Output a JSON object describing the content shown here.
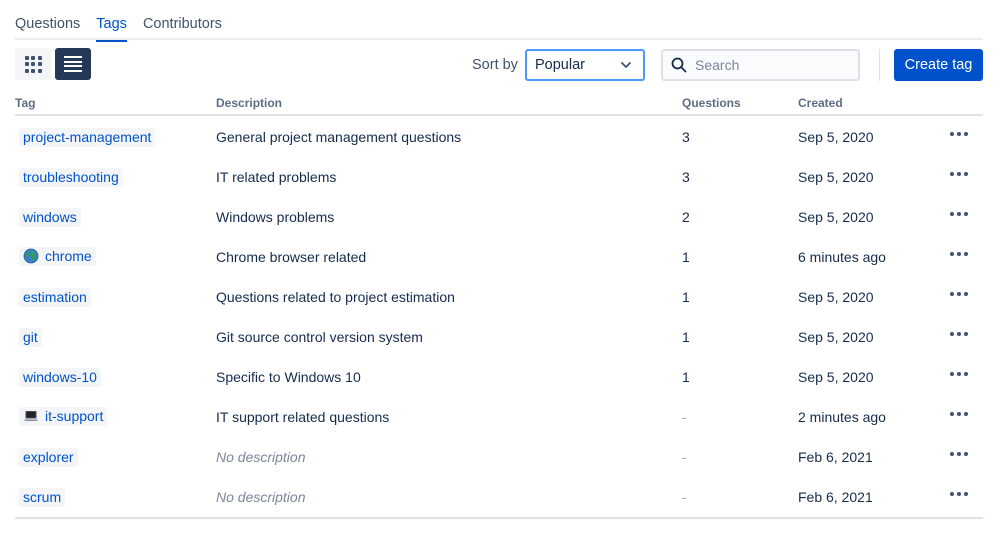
{
  "tabs": [
    {
      "label": "Questions",
      "active": false
    },
    {
      "label": "Tags",
      "active": true
    },
    {
      "label": "Contributors",
      "active": false
    }
  ],
  "toolbar": {
    "grid_view_icon": "grid-icon",
    "list_view_icon": "list-icon",
    "sort_label": "Sort by",
    "sort_value": "Popular",
    "search_placeholder": "Search",
    "search_value": "",
    "create_label": "Create tag"
  },
  "colors": {
    "accent": "#0052cc",
    "active_view": "#253858",
    "focus_border": "#4c9aff"
  },
  "table": {
    "headers": {
      "tag": "Tag",
      "description": "Description",
      "questions": "Questions",
      "created": "Created"
    },
    "rows": [
      {
        "tag": "project-management",
        "icon": "",
        "description": "General project management questions",
        "questions": "3",
        "created": "Sep 5, 2020"
      },
      {
        "tag": "troubleshooting",
        "icon": "",
        "description": "IT related problems",
        "questions": "3",
        "created": "Sep 5, 2020"
      },
      {
        "tag": "windows",
        "icon": "",
        "description": "Windows problems",
        "questions": "2",
        "created": "Sep 5, 2020"
      },
      {
        "tag": "chrome",
        "icon": "globe-icon",
        "description": "Chrome browser related",
        "questions": "1",
        "created": "6 minutes ago"
      },
      {
        "tag": "estimation",
        "icon": "",
        "description": "Questions related to project estimation",
        "questions": "1",
        "created": "Sep 5, 2020"
      },
      {
        "tag": "git",
        "icon": "",
        "description": "Git source control version system",
        "questions": "1",
        "created": "Sep 5, 2020"
      },
      {
        "tag": "windows-10",
        "icon": "",
        "description": "Specific to Windows 10",
        "questions": "1",
        "created": "Sep 5, 2020"
      },
      {
        "tag": "it-support",
        "icon": "laptop-icon",
        "description": "IT support related questions",
        "questions": "-",
        "created": "2 minutes ago"
      },
      {
        "tag": "explorer",
        "icon": "",
        "description": "No description",
        "questions": "-",
        "created": "Feb 6, 2021"
      },
      {
        "tag": "scrum",
        "icon": "",
        "description": "No description",
        "questions": "-",
        "created": "Feb 6, 2021"
      }
    ]
  }
}
